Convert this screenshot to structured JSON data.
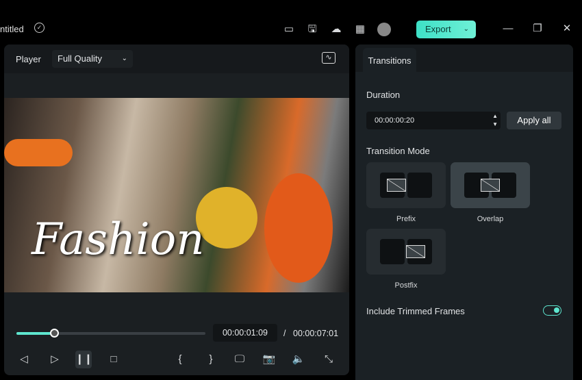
{
  "titlebar": {
    "title": "ntitled",
    "export_label": "Export",
    "icons": [
      "layout-icon",
      "save-icon",
      "cloud-upload-icon",
      "grid-icon",
      "avatar-icon"
    ]
  },
  "player": {
    "label": "Player",
    "quality": "Full Quality",
    "video_text": "Fashion",
    "current_time": "00:00:01:09",
    "separator": "/",
    "total_time": "00:00:07:01",
    "progress_percent": 20
  },
  "controls": {
    "icons": [
      "prev-frame-icon",
      "next-frame-icon",
      "pause-icon",
      "stop-icon",
      "mark-in-icon",
      "mark-out-icon",
      "display-icon",
      "snapshot-icon",
      "volume-icon",
      "fullscreen-icon"
    ]
  },
  "panel": {
    "tab": "Transitions",
    "duration_label": "Duration",
    "duration_value": "00:00:00:20",
    "apply_all": "Apply all",
    "mode_label": "Transition Mode",
    "modes": [
      {
        "label": "Prefix",
        "selected": false
      },
      {
        "label": "Overlap",
        "selected": true
      },
      {
        "label": "Postfix",
        "selected": false
      }
    ],
    "trimmed_label": "Include Trimmed Frames",
    "trimmed_on": true
  },
  "colors": {
    "accent": "#5ee6cf",
    "background": "#000000",
    "panel": "#1b2125"
  }
}
